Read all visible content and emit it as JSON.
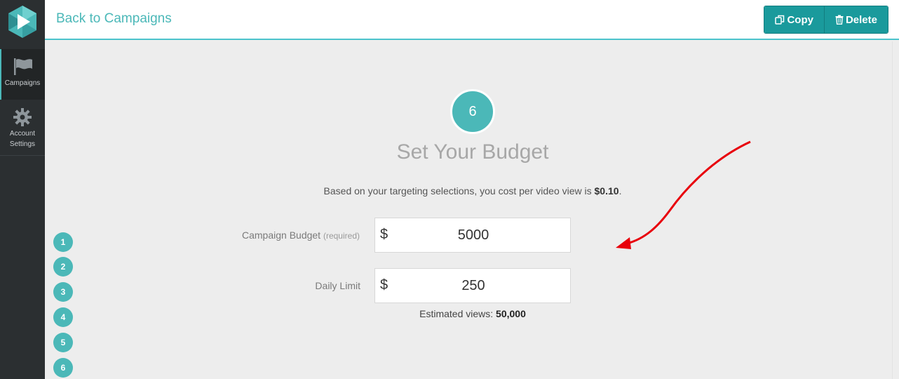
{
  "sidebar": {
    "items": [
      {
        "label": "Campaigns",
        "icon": "flag-icon"
      },
      {
        "label": "Account Settings",
        "icon": "gear-icon"
      }
    ]
  },
  "header": {
    "back_label": "Back to Campaigns",
    "copy_label": "Copy",
    "delete_label": "Delete"
  },
  "step": {
    "number": "6",
    "title": "Set Your Budget",
    "cost_prefix": "Based on your targeting selections, you cost per video view is ",
    "cost_value": "$0.10",
    "cost_suffix": "."
  },
  "budget": {
    "label": "Campaign Budget",
    "required_note": "(required)",
    "currency": "$",
    "value": "5000"
  },
  "daily": {
    "label": "Daily Limit",
    "currency": "$",
    "value": "250"
  },
  "estimate": {
    "label": "Estimated views: ",
    "value": "50,000"
  },
  "step_nav": [
    "1",
    "2",
    "3",
    "4",
    "5",
    "6"
  ],
  "colors": {
    "accent": "#4bb8b8",
    "button": "#1a9a9c",
    "sidebar": "#2b2f31",
    "annotation_arrow": "#e8000b"
  }
}
